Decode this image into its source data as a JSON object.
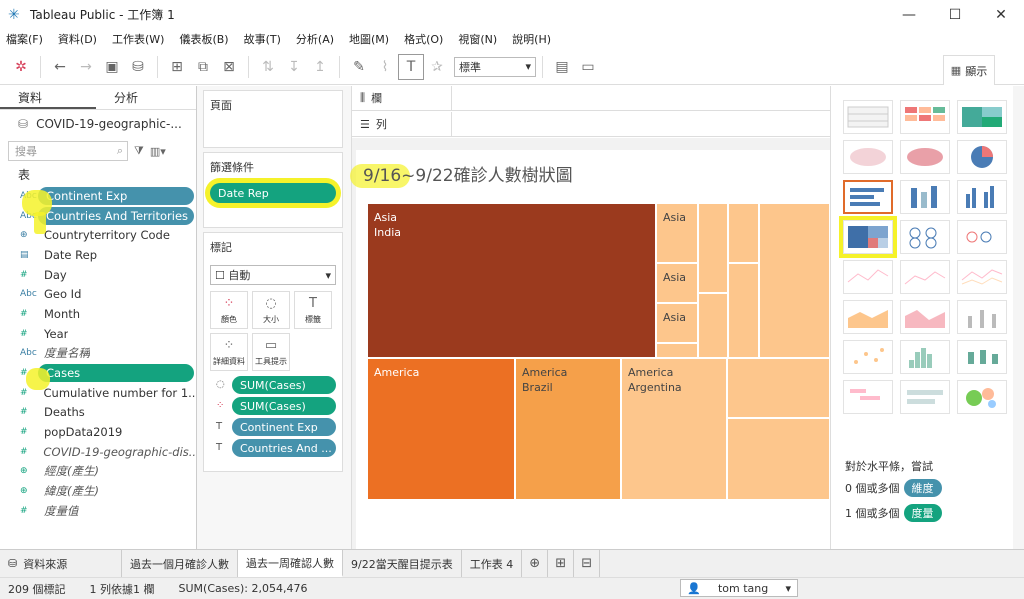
{
  "window": {
    "title": "Tableau Public - 工作簿 1"
  },
  "menu": [
    "檔案(F)",
    "資料(D)",
    "工作表(W)",
    "儀表板(B)",
    "故事(T)",
    "分析(A)",
    "地圖(M)",
    "格式(O)",
    "視窗(N)",
    "說明(H)"
  ],
  "toolbar": {
    "standard_select": "標準",
    "show_me_label": "顯示"
  },
  "data_pane": {
    "tabs": [
      "資料",
      "分析"
    ],
    "datasource": "COVID-19-geographic-...",
    "search_placeholder": "搜尋",
    "section": "表",
    "fields": [
      {
        "type": "Abc",
        "name": "Continent Exp"
      },
      {
        "type": "Abc",
        "name": "Countries And Territories"
      },
      {
        "type": "globe",
        "name": "Countryterritory Code"
      },
      {
        "type": "date",
        "name": "Date Rep"
      },
      {
        "type": "#",
        "name": "Day"
      },
      {
        "type": "Abc",
        "name": "Geo Id"
      },
      {
        "type": "#",
        "name": "Month"
      },
      {
        "type": "#",
        "name": "Year"
      },
      {
        "type": "Abc",
        "name": "度量名稱"
      },
      {
        "type": "#",
        "name": "Cases"
      },
      {
        "type": "#",
        "name": "Cumulative number for 1..."
      },
      {
        "type": "#",
        "name": "Deaths"
      },
      {
        "type": "#",
        "name": "popData2019"
      },
      {
        "type": "#",
        "name": "COVID-19-geographic-dis..."
      },
      {
        "type": "globe",
        "name": "經度(產生)"
      },
      {
        "type": "globe",
        "name": "緯度(產生)"
      },
      {
        "type": "#",
        "name": "度量值"
      }
    ]
  },
  "shelves": {
    "pages_label": "頁面",
    "filters_label": "篩選條件",
    "filter_pill": "Date Rep",
    "marks_label": "標記",
    "mark_type": "自動",
    "mark_buttons": [
      "顏色",
      "大小",
      "標籤",
      "詳細資料",
      "工具提示"
    ],
    "mark_pills": [
      "SUM(Cases)",
      "SUM(Cases)",
      "Continent Exp",
      "Countries And ..."
    ],
    "columns_label": "欄",
    "rows_label": "列"
  },
  "view": {
    "title": "9/16~9/22確診人數樹狀圖",
    "tiles": [
      {
        "line1": "Asia",
        "line2": "India"
      },
      {
        "line1": "Asia",
        "line2": ""
      },
      {
        "line1": "Asia",
        "line2": ""
      },
      {
        "line1": "Asia",
        "line2": ""
      },
      {
        "line1": "America",
        "line2": ""
      },
      {
        "line1": "America",
        "line2": "Brazil"
      },
      {
        "line1": "America",
        "line2": "Argentina"
      }
    ]
  },
  "show_me": {
    "hint_title": "對於水平條，嘗試",
    "hint_dim_prefix": "0 個或多個",
    "hint_dim_pill": "維度",
    "hint_meas_prefix": "1 個或多個",
    "hint_meas_pill": "度量"
  },
  "sheet_tabs": [
    "資料來源",
    "過去一個月確診人數",
    "過去一周確認人數",
    "9/22當天醒目提示表",
    "工作表 4"
  ],
  "status": {
    "marks": "209 個標記",
    "rows_cols": "1 列依據1 欄",
    "sum": "SUM(Cases): 2,054,476",
    "user": "tom tang"
  },
  "colors": {
    "accent_blue": "#4592ac",
    "accent_green": "#14a37f",
    "tile_india": "#9b3a1e",
    "tile_america": "#ec7023",
    "tile_brazil": "#f5a04a",
    "tile_light": "#fdc68c"
  }
}
